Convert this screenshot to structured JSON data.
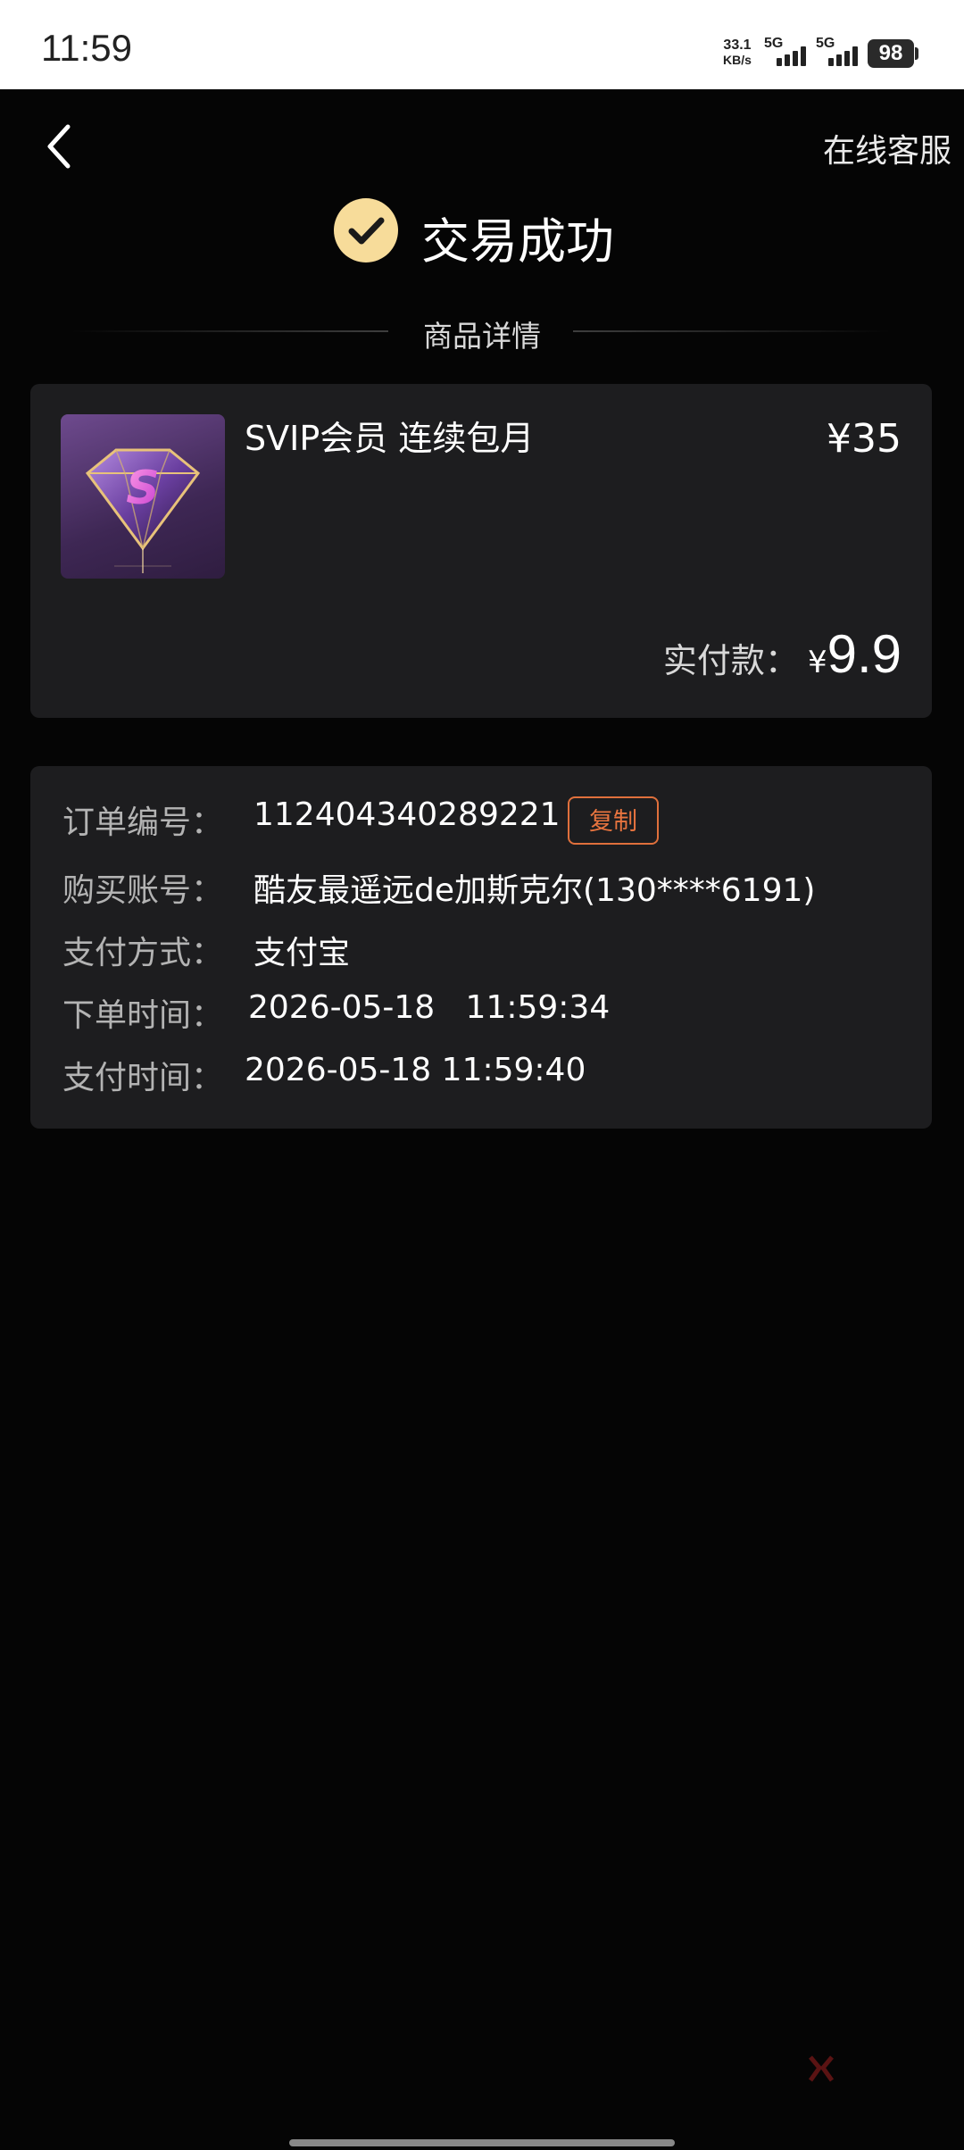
{
  "status_bar": {
    "time": "11:59",
    "net_speed_value": "33.1",
    "net_speed_unit": "KB/s",
    "sim1_label": "5G",
    "sim2_label": "5G",
    "battery": "98"
  },
  "header": {
    "service_label": "在线客服",
    "result_title": "交易成功"
  },
  "section_title": "商品详情",
  "product": {
    "name": "SVIP会员 连续包月",
    "price": "¥35",
    "paid_label": "实付款：",
    "paid_currency": "¥",
    "paid_amount": "9.9",
    "image_letter": "S"
  },
  "order": {
    "copy_label": "复制",
    "rows": [
      {
        "label": "订单编号：",
        "value": "112404340289221"
      },
      {
        "label": "购买账号：",
        "value": "酷友最遥远de加斯克尔(130****6191)"
      },
      {
        "label": "支付方式：",
        "value": "支付宝"
      },
      {
        "label": "下单时间：",
        "value": "2026-05-18   11:59:34"
      },
      {
        "label": "支付时间：",
        "value": "2026-05-18 11:59:40"
      }
    ]
  },
  "colors": {
    "background": "#050505",
    "card": "#1d1d1f",
    "success_icon": "#f7dc9a",
    "copy_accent": "#e8743f"
  },
  "icons": [
    "back-arrow-icon",
    "check-circle-icon",
    "diamond-icon"
  ]
}
